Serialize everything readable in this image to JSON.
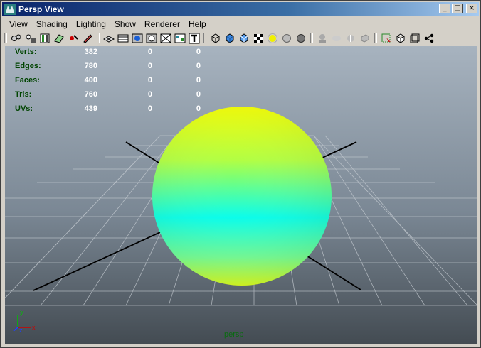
{
  "window": {
    "title": "Persp View",
    "minimize": "_",
    "maximize": "□",
    "close": "×"
  },
  "menu": {
    "items": [
      "View",
      "Shading",
      "Lighting",
      "Show",
      "Renderer",
      "Help"
    ]
  },
  "hud": {
    "rows": [
      {
        "label": "Verts:",
        "v1": "382",
        "v2": "0",
        "v3": "0"
      },
      {
        "label": "Edges:",
        "v1": "780",
        "v2": "0",
        "v3": "0"
      },
      {
        "label": "Faces:",
        "v1": "400",
        "v2": "0",
        "v3": "0"
      },
      {
        "label": "Tris:",
        "v1": "760",
        "v2": "0",
        "v3": "0"
      },
      {
        "label": "UVs:",
        "v1": "439",
        "v2": "0",
        "v3": "0"
      }
    ]
  },
  "viewport": {
    "camera_label": "persp"
  },
  "axis": {
    "x": "x",
    "y": "y",
    "z": "z"
  },
  "colors": {
    "sphere_top": "#f4ff00",
    "sphere_mid": "#00ffee",
    "grid": "#c8ced4",
    "axis_line": "#000000"
  }
}
